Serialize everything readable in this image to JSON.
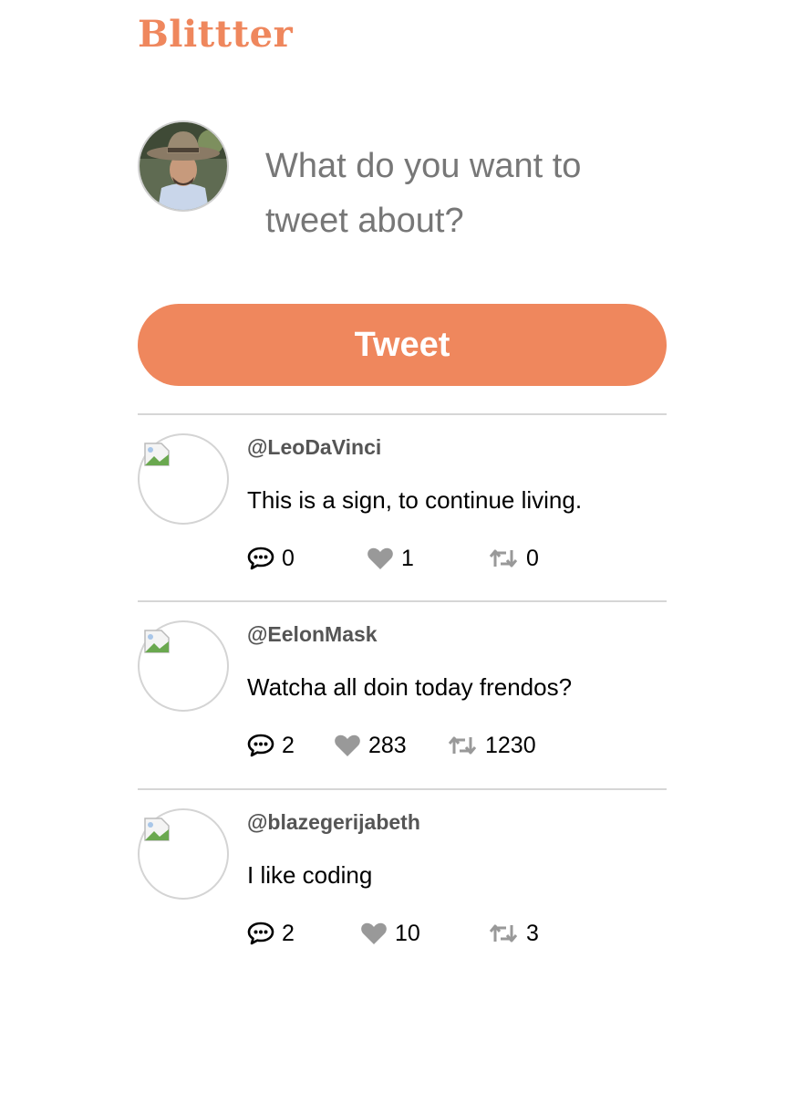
{
  "app": {
    "logo": "Blittter",
    "brand_color": "#EF875D"
  },
  "composer": {
    "placeholder": "What do you want to tweet about?",
    "tweet_button": "Tweet"
  },
  "icons": {
    "avatar": "user-avatar-photo",
    "comment": "speech-bubble-icon",
    "like": "heart-icon",
    "retweet": "retweet-icon",
    "broken_image": "broken-image-icon"
  },
  "tweets": [
    {
      "handle": "@LeoDaVinci",
      "text": "This is a sign, to continue living.",
      "comments": "0",
      "likes": "1",
      "retweets": "0"
    },
    {
      "handle": "@EelonMask",
      "text": "Watcha all doin today frendos?",
      "comments": "2",
      "likes": "283",
      "retweets": "1230"
    },
    {
      "handle": "@blazegerijabeth",
      "text": "I like coding",
      "comments": "2",
      "likes": "10",
      "retweets": "3"
    }
  ]
}
